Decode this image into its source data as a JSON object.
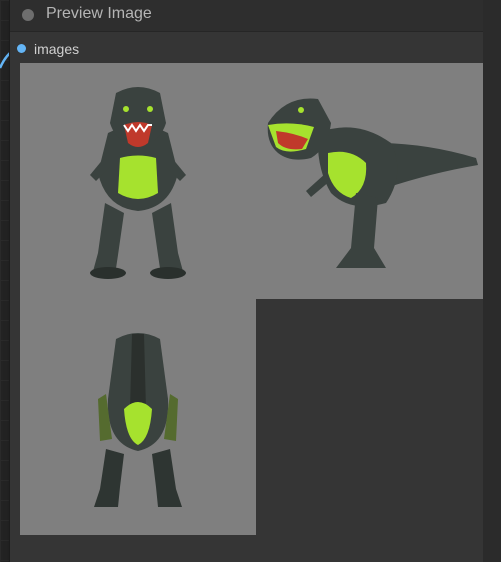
{
  "node": {
    "title": "Preview Image",
    "input_slot_label": "images"
  },
  "images": [
    {
      "view": "front",
      "icon": "dinosaur-toy-front-image"
    },
    {
      "view": "side",
      "icon": "dinosaur-toy-side-image"
    },
    {
      "view": "back",
      "icon": "dinosaur-toy-back-image"
    }
  ],
  "colors": {
    "accent_slot": "#64b5f6",
    "image_background": "#7f7f7f",
    "toy_green": "#a6e22e",
    "toy_dark": "#3a423f"
  }
}
